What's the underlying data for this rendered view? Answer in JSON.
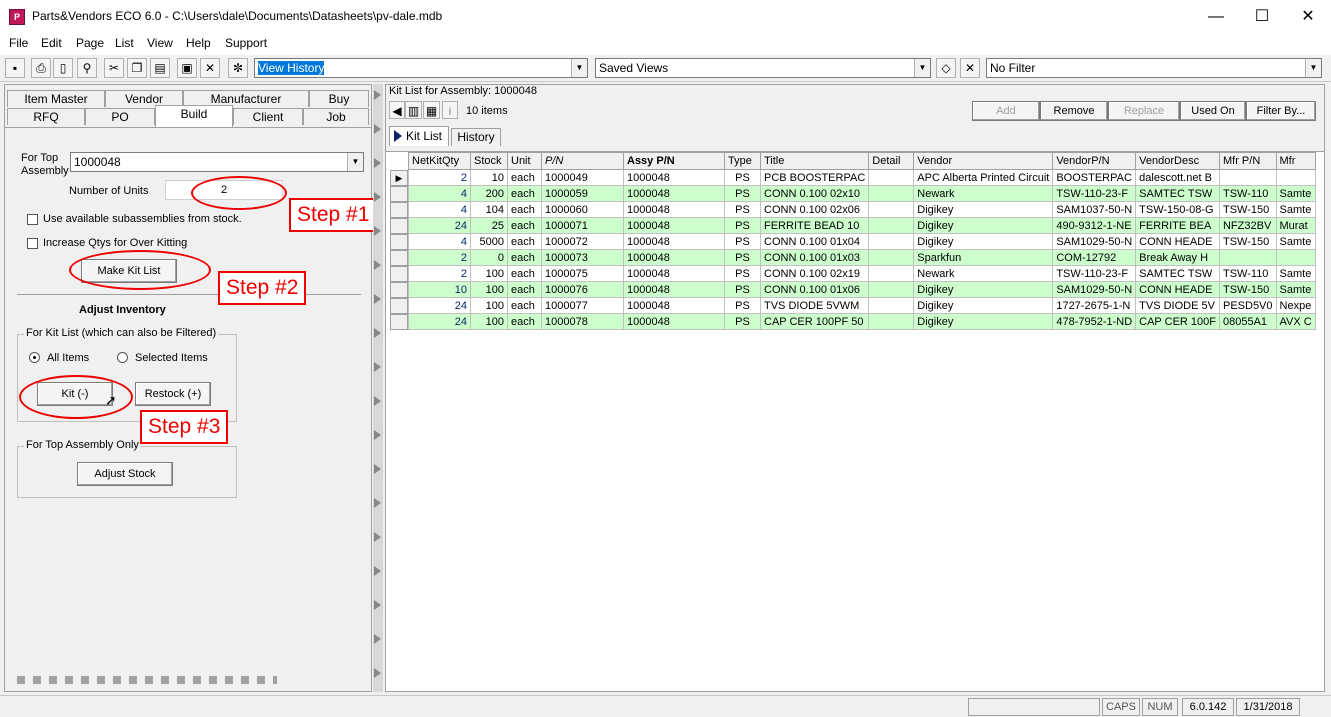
{
  "window": {
    "title": "Parts&Vendors ECO 6.0 - C:\\Users\\dale\\Documents\\Datasheets\\pv-dale.mdb",
    "minimize": "—",
    "maximize": "☐",
    "close": "✕"
  },
  "menu": [
    "File",
    "Edit",
    "Page",
    "List",
    "View",
    "Help",
    "Support"
  ],
  "toolbar": {
    "view_combo": "View History",
    "saved_views": "Saved Views",
    "filter_combo": "No Filter"
  },
  "tabs_row1": [
    "Item Master",
    "Vendor",
    "Manufacturer",
    "Buy"
  ],
  "tabs_row2": [
    "RFQ",
    "PO",
    "Build",
    "Client",
    "Job"
  ],
  "build": {
    "top_assembly_label": "For Top\nAssembly",
    "top_assembly_value": "1000048",
    "units_label": "Number of Units",
    "units_value": "2",
    "use_subassemblies": "Use available subassemblies from stock.",
    "increase_qtys": "Increase Qtys for Over Kitting",
    "make_kit_list": "Make Kit List",
    "adjust_inventory": "Adjust Inventory",
    "kit_list_group": "For Kit List  (which can also be Filtered)",
    "all_items": "All Items",
    "selected_items": "Selected Items",
    "kit_button": "Kit (-)",
    "restock_button": "Restock (+)",
    "top_assembly_group": "For Top Assembly Only",
    "adjust_stock": "Adjust Stock"
  },
  "steps": [
    "Step #1",
    "Step #2",
    "Step #3"
  ],
  "kit": {
    "header_label": "Kit List for Assembly:  1000048",
    "item_count": "10 items",
    "add": "Add",
    "remove": "Remove",
    "replace": "Replace",
    "used_on": "Used On",
    "filter_by": "Filter By...",
    "tab_kit_list": "Kit List",
    "tab_history": "History",
    "columns": [
      "NetKitQty",
      "Stock",
      "Unit",
      "P/N",
      "Assy P/N",
      "Type",
      "Title",
      "Detail",
      "Vendor",
      "VendorP/N",
      "VendorDesc",
      "Mfr P/N",
      "Mfr"
    ],
    "rows": [
      [
        "2",
        "10",
        "each",
        "1000049",
        "1000048",
        "PS",
        "PCB BOOSTERPAC",
        "",
        "APC Alberta Printed Circuit",
        "BOOSTERPAC",
        "dalescott.net B",
        "",
        ""
      ],
      [
        "4",
        "200",
        "each",
        "1000059",
        "1000048",
        "PS",
        "CONN 0.100 02x10",
        "",
        "Newark",
        "TSW-110-23-F",
        "SAMTEC TSW",
        "TSW-110",
        "Samte"
      ],
      [
        "4",
        "104",
        "each",
        "1000060",
        "1000048",
        "PS",
        "CONN 0.100 02x06",
        "",
        "Digikey",
        "SAM1037-50-N",
        "TSW-150-08-G",
        "TSW-150",
        "Samte"
      ],
      [
        "24",
        "25",
        "each",
        "1000071",
        "1000048",
        "PS",
        "FERRITE BEAD 10",
        "",
        "Digikey",
        "490-9312-1-NE",
        "FERRITE BEA",
        "NFZ32BV",
        "Murat"
      ],
      [
        "4",
        "5000",
        "each",
        "1000072",
        "1000048",
        "PS",
        "CONN 0.100 01x04",
        "",
        "Digikey",
        "SAM1029-50-N",
        "CONN HEADE",
        "TSW-150",
        "Samte"
      ],
      [
        "2",
        "0",
        "each",
        "1000073",
        "1000048",
        "PS",
        "CONN 0.100 01x03",
        "",
        "Sparkfun",
        "COM-12792",
        "Break Away H",
        "",
        ""
      ],
      [
        "2",
        "100",
        "each",
        "1000075",
        "1000048",
        "PS",
        "CONN 0.100 02x19",
        "",
        "Newark",
        "TSW-110-23-F",
        "SAMTEC TSW",
        "TSW-110",
        "Samte"
      ],
      [
        "10",
        "100",
        "each",
        "1000076",
        "1000048",
        "PS",
        "CONN 0.100 01x06",
        "",
        "Digikey",
        "SAM1029-50-N",
        "CONN HEADE",
        "TSW-150",
        "Samte"
      ],
      [
        "24",
        "100",
        "each",
        "1000077",
        "1000048",
        "PS",
        "TVS DIODE 5VWM",
        "",
        "Digikey",
        "1727-2675-1-N",
        "TVS DIODE 5V",
        "PESD5V0",
        "Nexpe"
      ],
      [
        "24",
        "100",
        "each",
        "1000078",
        "1000048",
        "PS",
        "CAP CER 100PF 50",
        "",
        "Digikey",
        "478-7952-1-ND",
        "CAP CER 100F",
        "08055A1",
        "AVX C"
      ]
    ]
  },
  "status": {
    "caps": "CAPS",
    "num": "NUM",
    "version": "6.0.142",
    "date": "1/31/2018"
  }
}
